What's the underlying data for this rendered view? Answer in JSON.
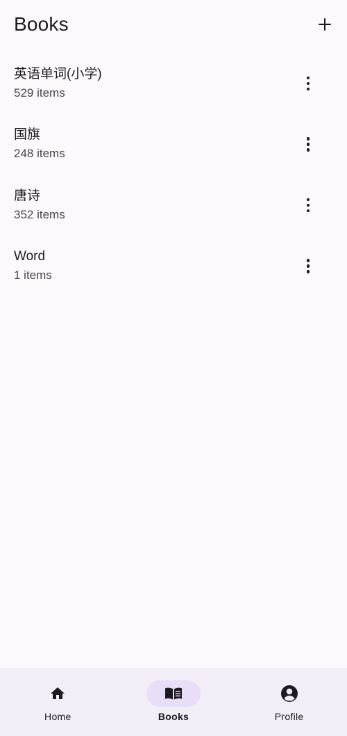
{
  "header": {
    "title": "Books",
    "add_icon": "plus-icon"
  },
  "books": [
    {
      "title": "英语单词(小学)",
      "count": "529 items"
    },
    {
      "title": "国旗",
      "count": "248 items"
    },
    {
      "title": "唐诗",
      "count": "352 items"
    },
    {
      "title": "Word",
      "count": "1 items"
    }
  ],
  "nav": {
    "items": [
      {
        "label": "Home",
        "icon": "home-icon"
      },
      {
        "label": "Books",
        "icon": "book-open-icon",
        "active": true
      },
      {
        "label": "Profile",
        "icon": "account-circle-icon"
      }
    ]
  },
  "colors": {
    "background": "#fdf8fc",
    "nav_background": "#f3edf7",
    "active_indicator": "#e8def8",
    "text_primary": "#1d1b20",
    "text_secondary": "#49454f"
  }
}
